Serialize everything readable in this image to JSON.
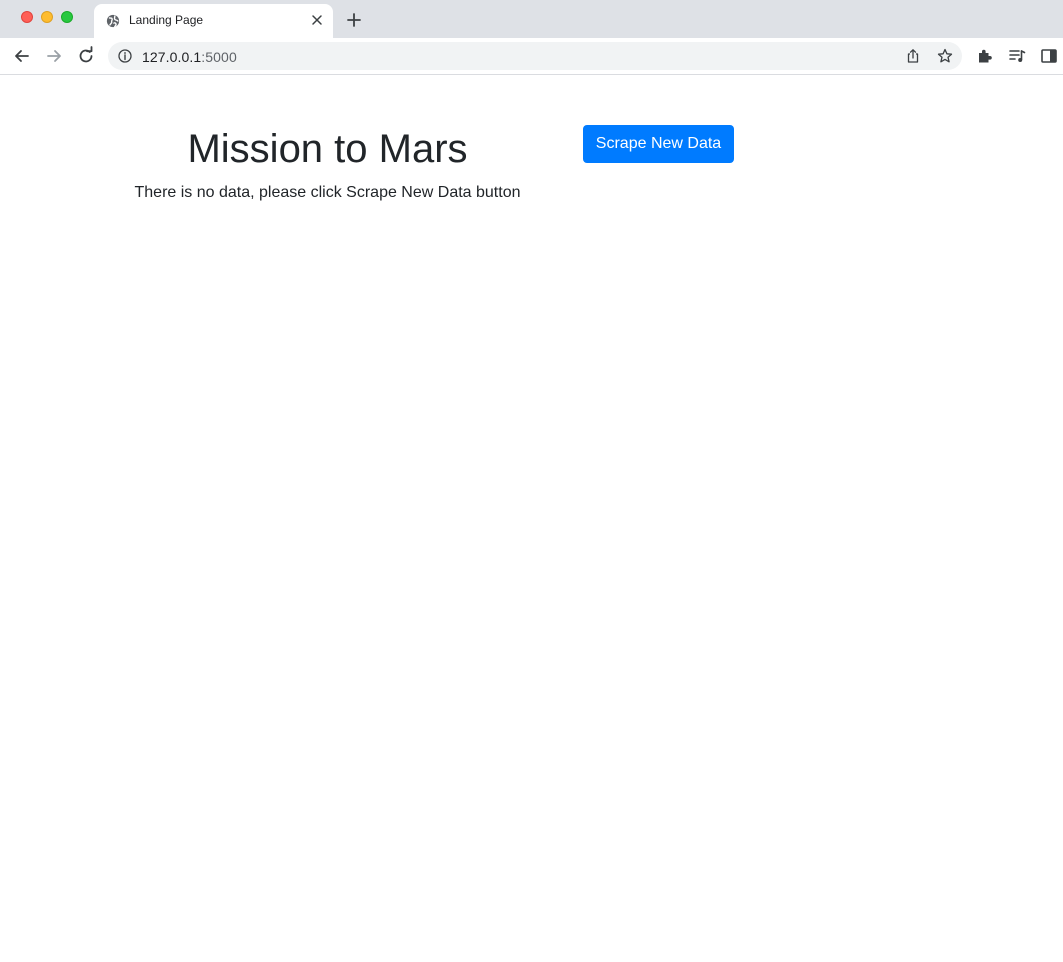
{
  "browser": {
    "tab": {
      "title": "Landing Page",
      "favicon": "globe-icon"
    },
    "address_bar": {
      "host": "127.0.0.1",
      "port": ":5000"
    },
    "icons": {
      "back": "arrow-left-icon",
      "forward": "arrow-right-icon",
      "reload": "reload-icon",
      "info": "info-icon",
      "share": "share-icon",
      "bookmark": "star-icon",
      "extensions": "puzzle-icon",
      "media": "media-controls-icon",
      "side_panel": "side-panel-icon",
      "new_tab": "plus-icon",
      "close_tab": "close-icon"
    }
  },
  "page": {
    "title": "Mission to Mars",
    "message": "There is no data, please click Scrape New Data button",
    "scrape_button_label": "Scrape New Data"
  },
  "colors": {
    "primary": "#007bff",
    "text": "#212529",
    "tabstrip_bg": "#dee1e6",
    "omnibox_bg": "#f1f3f4"
  }
}
